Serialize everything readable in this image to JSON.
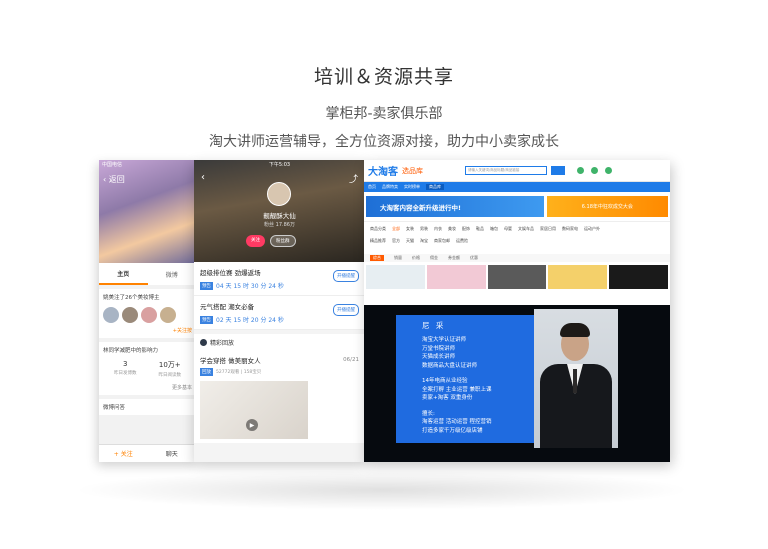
{
  "hero": {
    "title": "培训＆资源共享",
    "subtitle": "掌柜邦-卖家俱乐部",
    "description": "淘大讲师运营辅导，全方位资源对接，助力中小卖家成长"
  },
  "phone_weibo": {
    "status_left": "中国电信",
    "back_label": "返回",
    "tabs": [
      "主页",
      "微博"
    ],
    "card1_title": "姚美注了26个美妆博主",
    "card1_more": "+关注按",
    "card2_title": "林同学减肥中的影响力",
    "stats": [
      {
        "value": "3",
        "label": "昨日发博数"
      },
      {
        "value": "10万+",
        "label": "昨日阅读数"
      }
    ],
    "stats_more": "更多基本",
    "card3_title": "微博问答",
    "bottom": {
      "follow": "+ 关注",
      "chat": "聊天"
    }
  },
  "phone_stream": {
    "status_time": "下午5:03",
    "name": "靓靓酥大仙",
    "fans": "粉丝 17.86万",
    "follow_btn": "关注",
    "fanclub_btn": "粉丝群",
    "items": [
      {
        "title": "超级排位赛 劲爆返场",
        "tag": "预告",
        "time": "04 天 15 时 30 分 24 秒",
        "btn": "开播提醒"
      },
      {
        "title": "元气搭配 潮女必备",
        "tag": "预告",
        "time": "02 天 15 时 20 分 24 秒",
        "btn": "开播提醒"
      }
    ],
    "section_title": "精彩回放",
    "replay": {
      "title": "学会穿搭 做美丽女人",
      "tag": "回放",
      "meta": "52772观看 | 158宝贝",
      "date": "06/21"
    }
  },
  "desktop": {
    "logo": "大淘客",
    "logo_sub": "选品库",
    "search_placeholder": "请输入关键词/商品标题/商品链接",
    "nav": [
      "首页",
      "品牌特卖",
      "实时榜单",
      "商品库"
    ],
    "banner_left": "大淘客内容全新升级进行中!",
    "banner_right": "6.18年中狂欢成交大会",
    "filter_row1": [
      "商品分类",
      "全部",
      "女装",
      "男装",
      "内衣",
      "美妆",
      "配饰",
      "鞋品",
      "箱包",
      "母婴",
      "文娱车品",
      "家居日用",
      "数码家电",
      "运动户外"
    ],
    "filter_row2": [
      "精品推荐",
      "官方",
      "天猫",
      "淘宝",
      "商家包邮",
      "运费险"
    ],
    "sort": [
      "综合",
      "销量",
      "价格",
      "佣金",
      "券金额",
      "优惠"
    ],
    "overlay": {
      "name": "尼 采",
      "lines_a": [
        "淘宝大学认证讲师",
        "万堂书院讲师",
        "天猫成长讲师",
        "数据商品大盘认证讲师"
      ],
      "lines_b": [
        "14年电商从业经验",
        "全案打孵 主业运营 兼职上课",
        "卖家+淘客 双重身份"
      ],
      "lines_c": [
        "擅长:",
        "淘客运营 活动运营 程控营销",
        "打造多家千万级亿级店铺"
      ]
    }
  },
  "colors": {
    "brand_blue": "#1e7be8",
    "orange": "#ff8200",
    "panel_blue": "#1f6be0"
  }
}
